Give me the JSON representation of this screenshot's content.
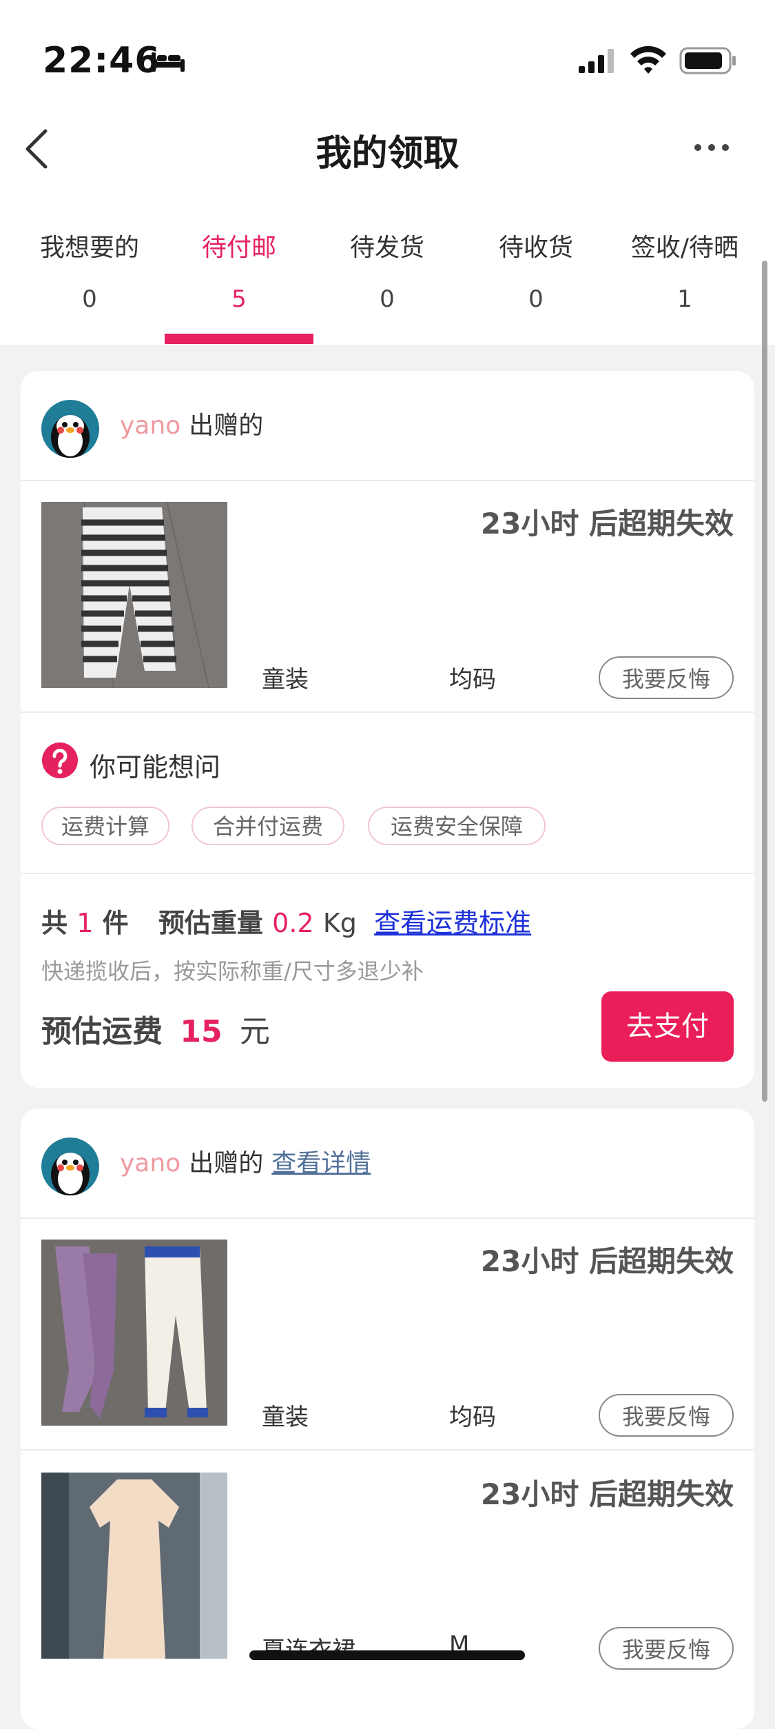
{
  "status": {
    "time": "22:46"
  },
  "nav": {
    "title": "我的领取"
  },
  "tabs": [
    {
      "label": "我想要的",
      "count": "0"
    },
    {
      "label": "待付邮",
      "count": "5"
    },
    {
      "label": "待发货",
      "count": "0"
    },
    {
      "label": "待收货",
      "count": "0"
    },
    {
      "label": "签收/待晒",
      "count": "1"
    }
  ],
  "colors": {
    "accent": "#e5225f",
    "link": "#1d31d8",
    "giver": "#ee9aa0"
  },
  "card1": {
    "giver_name": "yano",
    "giver_suffix": "出赠的",
    "item": {
      "countdown": "23小时 后超期失效",
      "category": "童装",
      "size": "均码",
      "regret": "我要反悔"
    },
    "faq_title": "你可能想问",
    "chips": [
      "运费计算",
      "合并付运费",
      "运费安全保障"
    ],
    "summary": {
      "prefix": "共",
      "count": "1",
      "unit": "件",
      "weight_label": "预估重量",
      "weight": "0.2",
      "weight_unit": "Kg",
      "link": "查看运费标准"
    },
    "hint": "快递揽收后，按实际称重/尺寸多退少补",
    "fee_label": "预估运费",
    "fee": "15",
    "fee_unit": "元",
    "pay_button": "去支付"
  },
  "card2": {
    "giver_name": "yano",
    "giver_suffix": "出赠的",
    "detail_link": "查看详情",
    "items": [
      {
        "countdown": "23小时 后超期失效",
        "category": "童装",
        "size": "均码",
        "regret": "我要反悔"
      },
      {
        "countdown": "23小时 后超期失效",
        "category": "夏连衣裙",
        "size": "M",
        "regret": "我要反悔"
      }
    ]
  }
}
